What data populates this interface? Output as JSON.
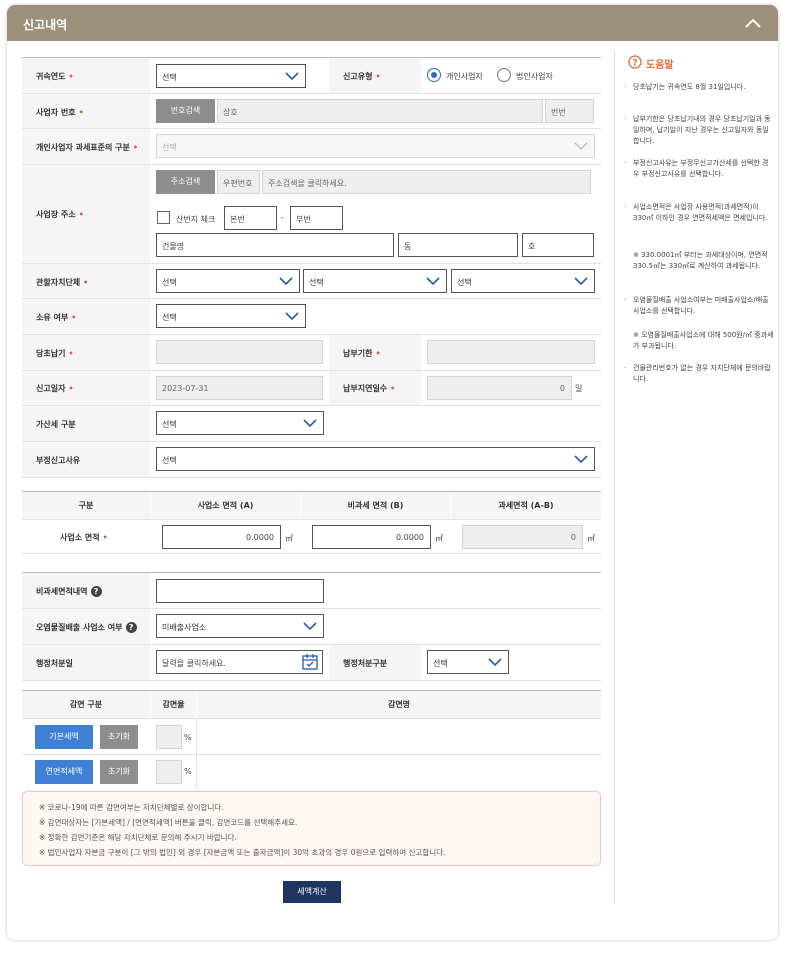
{
  "header": {
    "title": "신고내역"
  },
  "form": {
    "tax_year": {
      "label": "귀속연도",
      "value": "선택"
    },
    "report_type": {
      "label": "신고유형",
      "options": [
        "개인사업자",
        "법인사업자"
      ],
      "selected": "개인사업자"
    },
    "biz_number": {
      "label": "사업자 번호",
      "search_button": "번호검색",
      "trade_name": "상호",
      "number": "번번"
    },
    "industry_code": {
      "label": "개인사업자 과세표준의 구분",
      "value": "선택"
    },
    "address": {
      "label": "사업장 주소",
      "search_button": "주소검색",
      "zip_placeholder": "우편번호",
      "address_placeholder": "주소검색을 클릭하세요.",
      "mountain_label": "산번지 체크",
      "main_no": "본번",
      "dash": "-",
      "sub_no": "부번",
      "building": "건물명",
      "dong": "동",
      "ho": "호"
    },
    "local_gov": {
      "label": "관할자치단체",
      "selects": [
        "선택",
        "선택",
        "선택"
      ]
    },
    "ownership": {
      "label": "소유 여부",
      "value": "선택"
    },
    "original_tax": {
      "label": "당초납기",
      "value": ""
    },
    "due_date": {
      "label": "납부기한",
      "value": ""
    },
    "report_date": {
      "label": "신고일자",
      "value": "2023-07-31"
    },
    "late_days": {
      "label": "납부지연일수",
      "value": "0",
      "unit": "일"
    },
    "penalty_type": {
      "label": "가산세 구분",
      "value": "선택"
    },
    "improper_reason": {
      "label": "부정신고사유",
      "value": "선택"
    }
  },
  "area_table": {
    "headers": [
      "구분",
      "사업소 면적 (A)",
      "비과세 면적 (B)",
      "과세면적 (A-B)"
    ],
    "row_label": "사업소 면적",
    "values": [
      "0.0000",
      "0.0000",
      "0"
    ],
    "unit": "㎡"
  },
  "extra": {
    "nontax_detail": {
      "label": "비과세면적내역",
      "value": ""
    },
    "polluter": {
      "label": "오염물질배출 사업소 여부",
      "value": "미배출사업소"
    },
    "admin_date": {
      "label": "행정처분일",
      "placeholder": "달력을 클릭하세요."
    },
    "admin_type": {
      "label": "행정처분구분",
      "value": "선택"
    }
  },
  "reduction_table": {
    "headers": [
      "감면 구분",
      "감면율",
      "감면명"
    ],
    "rows": [
      {
        "button": "기본세액",
        "reset": "초기화",
        "rate": "",
        "unit": "%"
      },
      {
        "button": "연면적세액",
        "reset": "초기화",
        "rate": "",
        "unit": "%"
      }
    ]
  },
  "notices": [
    "※ 코로나-19에 따른 감면여부는 자치단체별로 상이합니다.",
    "※ 감면대상자는 [기본세액] / [연면적세액] 버튼을 클릭, 감면코드를 선택해주세요.",
    "※ 정확한 감면기준은 해당 자치단체로 문의해 주시기 바랍니다.",
    "※ 법인사업자 자본금 구분이 [그 밖의 법인] 외 경우 [자본금액 또는 출자금액]이 30억 초과의 경우 0원으로 입력하여 신고합니다."
  ],
  "submit_button": "세액계산",
  "help": {
    "title": "도움말",
    "items": [
      "당초납기는 귀속연도 8월 31일입니다.",
      "납부기한은 당초납기내의 경우 당초납기일과 동일하며, 납기일이 지난 경우는 신고일자와 동일합니다.",
      "부정신고사유는 부정무신고가산세를 선택한 경우 부정신고사유를 선택합니다.",
      "사업소면적은 사업장 사용면적(과세면적)이 330㎡ 이하인 경우 연면적세액은 면세입니다.",
      "※ 330.0001㎡ 부터는 과세대상이며, 연면적 330.5㎡는 330㎡로 계산하여 과세됩니다.",
      "오염물질배출 사업소여부는 미배출사업소/배출사업소를 선택합니다.",
      "※ 오염물질배출사업소에 대해 500원/㎡ 중과세가 부과됩니다.",
      "건물관리번호가 없는 경우 자치단체에 문의바랍니다."
    ]
  },
  "colors": {
    "header": "#9c8f7c",
    "accent": "#3f7fd4",
    "navy": "#1e3461",
    "help": "#e07139"
  }
}
